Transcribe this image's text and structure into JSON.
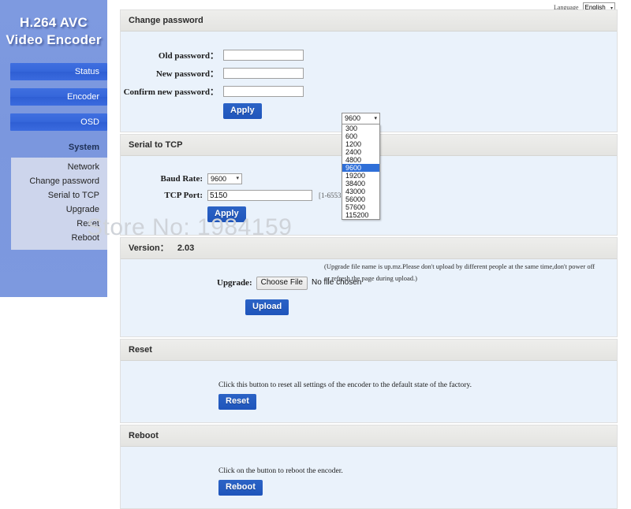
{
  "sidebar": {
    "logo_line1": "H.264 AVC",
    "logo_line2": "Video Encoder",
    "nav": [
      {
        "label": "Status"
      },
      {
        "label": "Encoder"
      },
      {
        "label": "OSD"
      }
    ],
    "active_parent": "System",
    "submenu": [
      {
        "label": "Network"
      },
      {
        "label": "Change password"
      },
      {
        "label": "Serial to TCP"
      },
      {
        "label": "Upgrade"
      },
      {
        "label": "Reset"
      },
      {
        "label": "Reboot"
      }
    ]
  },
  "language": {
    "label": "Language",
    "selected": "English",
    "arrow": "▾"
  },
  "change_password": {
    "title": "Change password",
    "old_label": "Old password：",
    "new_label": "New password：",
    "confirm_label": "Confirm new password：",
    "old_value": "",
    "new_value": "",
    "confirm_value": "",
    "apply_label": "Apply"
  },
  "serial_to_tcp": {
    "title": "Serial to TCP",
    "baud_label": "Baud Rate:",
    "baud_value": "9600",
    "port_label": "TCP Port:",
    "port_value": "5150",
    "port_hint": "[1-65535]",
    "apply_label": "Apply",
    "arrow": "▾"
  },
  "baud_dropdown": {
    "current": "9600",
    "arrow": "▾",
    "options": [
      "300",
      "600",
      "1200",
      "2400",
      "4800",
      "9600",
      "19200",
      "38400",
      "43000",
      "56000",
      "57600",
      "115200"
    ],
    "selected_index": 5
  },
  "version": {
    "title": "Version：",
    "number": "2.03",
    "upgrade_label": "Upgrade:",
    "choose_file_label": "Choose File",
    "no_file_label": "No file chosen",
    "note": "(Upgrade file name is up.mz.Please don't upload by different people at the same time,don't power off or refresh the page during upload.)",
    "upload_label": "Upload"
  },
  "reset": {
    "title": "Reset",
    "description": "Click this button to reset all settings of the encoder to the default state of the factory.",
    "button_label": "Reset"
  },
  "reboot": {
    "title": "Reboot",
    "description": "Click on the button to reboot the encoder.",
    "button_label": "Reboot"
  },
  "watermark": "Store No: 1984159",
  "colors": {
    "sidebar_blue": "#7b97de",
    "nav_blue": "#3566da",
    "button_blue": "#1f55bb",
    "panel_body": "#eaf2fb",
    "panel_head": "#e7e7e4",
    "dropdown_highlight": "#2f6fd8"
  }
}
